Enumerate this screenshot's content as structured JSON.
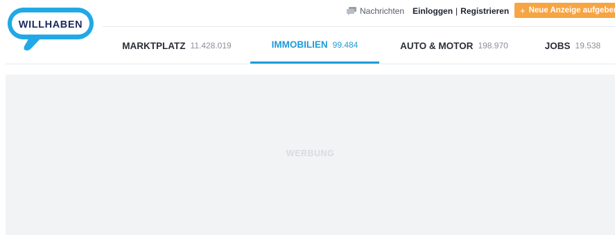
{
  "brand": {
    "logo_text": "WILLHABEN",
    "logo_color": "#21a8e6",
    "logo_text_color": "#1c2a5e"
  },
  "header": {
    "messages_label": "Nachrichten",
    "messages_icon": "chat-bubbles-icon",
    "login_label": "Einloggen",
    "separator": "|",
    "register_label": "Registrieren",
    "new_ad_plus": "+",
    "new_ad_label": "Neue Anzeige aufgeben",
    "new_ad_color": "#f7a442"
  },
  "nav": {
    "active_color": "#1e9bd7",
    "tabs": [
      {
        "label": "MARKTPLATZ",
        "count": "11.428.019",
        "active": false
      },
      {
        "label": "IMMOBILIEN",
        "count": "99.484",
        "active": true
      },
      {
        "label": "AUTO & MOTOR",
        "count": "198.970",
        "active": false
      },
      {
        "label": "JOBS",
        "count": "19.538",
        "active": false
      }
    ]
  },
  "advert": {
    "label": "WERBUNG"
  }
}
